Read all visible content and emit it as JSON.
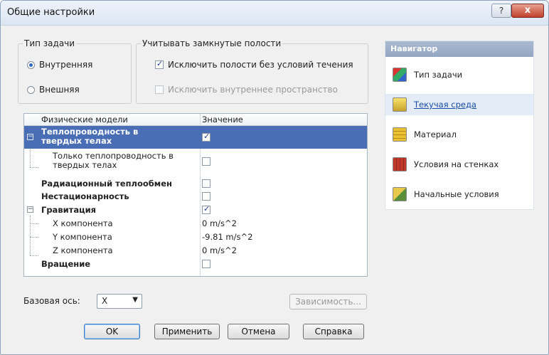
{
  "window": {
    "title": "Общие настройки",
    "help_label": "?",
    "close_label": "x"
  },
  "task_type": {
    "legend": "Тип задачи",
    "options": [
      {
        "label": "Внутренняя",
        "selected": true
      },
      {
        "label": "Внешняя",
        "selected": false
      }
    ]
  },
  "cavities": {
    "legend": "Учитывать замкнутые полости",
    "options": [
      {
        "label": "Исключить полости без условий течения",
        "checked": true
      },
      {
        "label": "Исключить внутреннее пространство",
        "checked": false,
        "disabled": true
      }
    ]
  },
  "grid": {
    "headers": [
      "Физические модели",
      "Значение"
    ],
    "rows": [
      {
        "name_line1": "Теплопроводность в",
        "name_line2": "твердых телах",
        "checked": true,
        "selected": true,
        "bold": true
      },
      {
        "name_line1": "Только теплопроводность в",
        "name_line2": "твердых телах",
        "checked": false
      },
      {
        "name": "Радиационный теплообмен",
        "checked": false,
        "bold": true
      },
      {
        "name": "Нестационарность",
        "checked": false,
        "bold": true
      },
      {
        "name": "Гравитация",
        "checked": true,
        "bold": true
      },
      {
        "name": "X компонента",
        "value": "0 m/s^2"
      },
      {
        "name": "Y компонента",
        "value": "-9.81 m/s^2"
      },
      {
        "name": "Z компонента",
        "value": "0 m/s^2"
      },
      {
        "name": "Вращение",
        "checked": false,
        "bold": true
      }
    ]
  },
  "navigator": {
    "title": "Навигатор",
    "items": [
      {
        "label": "Тип задачи",
        "icon": "task-type-icon"
      },
      {
        "label": "Текучая среда",
        "icon": "fluid-icon",
        "active": true
      },
      {
        "label": "Материал",
        "icon": "material-icon"
      },
      {
        "label": "Условия на стенках",
        "icon": "wall-conditions-icon"
      },
      {
        "label": "Начальные условия",
        "icon": "initial-conditions-icon"
      }
    ]
  },
  "base_axis": {
    "label": "Базовая ось:",
    "value": "X"
  },
  "buttons": {
    "dependency": "Зависимость...",
    "ok": "OK",
    "apply": "Применить",
    "cancel": "Отмена",
    "help": "Справка"
  }
}
